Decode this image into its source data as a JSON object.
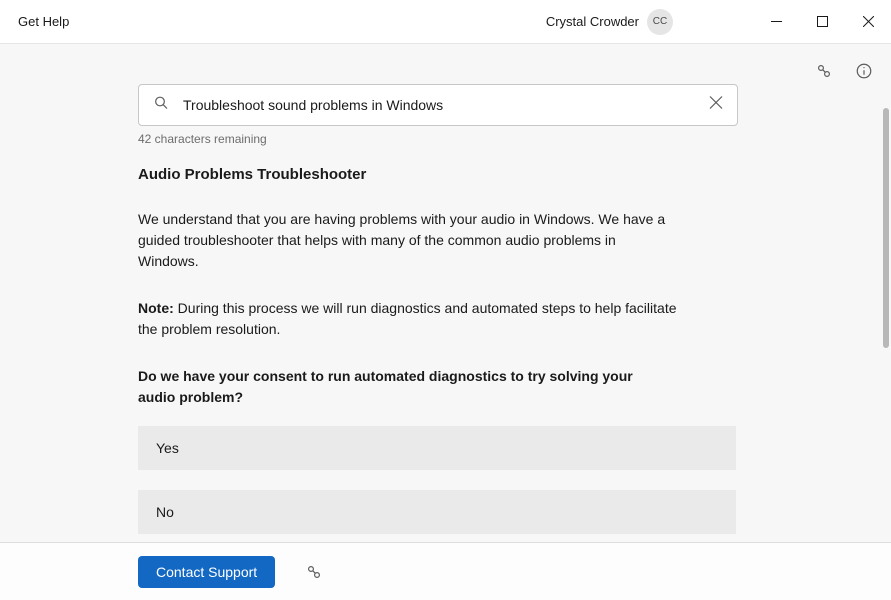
{
  "window": {
    "title": "Get Help"
  },
  "user": {
    "name": "Crystal Crowder",
    "initials": "CC"
  },
  "search": {
    "value": "Troubleshoot sound problems in Windows",
    "char_remaining": "42 characters remaining"
  },
  "article": {
    "heading": "Audio Problems Troubleshooter",
    "intro": "We understand that you are having problems with your audio in Windows. We have a guided troubleshooter that helps with many of the common audio problems in Windows.",
    "note_label": "Note:",
    "note_text": " During this process we will run diagnostics and automated steps to help facilitate the problem resolution.",
    "question": "Do we have your consent to run automated diagnostics to try solving your audio problem?",
    "options": {
      "yes": "Yes",
      "no": "No"
    }
  },
  "footer": {
    "contact_label": "Contact Support"
  }
}
